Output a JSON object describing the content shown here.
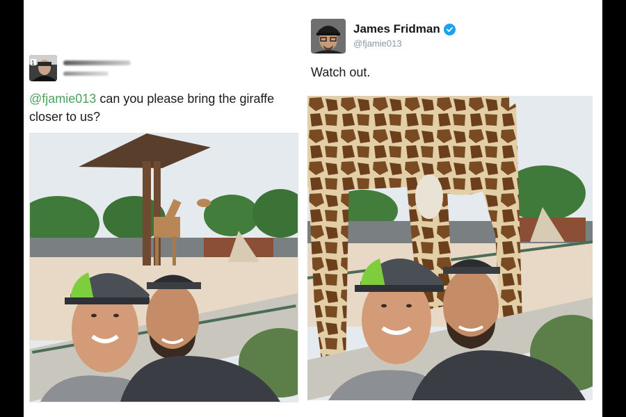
{
  "left_tweet": {
    "avatar_icon": "user-avatar-icon",
    "name_obscured": true,
    "mention": "@fjamie013",
    "text_rest": " can you please bring the giraffe closer to us?",
    "photo_icon": "selfie-with-distant-giraffe-image"
  },
  "right_tweet": {
    "avatar_icon": "user-avatar-icon",
    "name": "James Fridman",
    "verified_icon": "verified-badge-icon",
    "handle": "@fjamie013",
    "text": "Watch out.",
    "photo_icon": "selfie-with-giraffe-closeup-image"
  },
  "colors": {
    "mention": "#4aa35a",
    "verified": "#1da1f2",
    "handle": "#8899a6",
    "background_frame": "#000000"
  }
}
